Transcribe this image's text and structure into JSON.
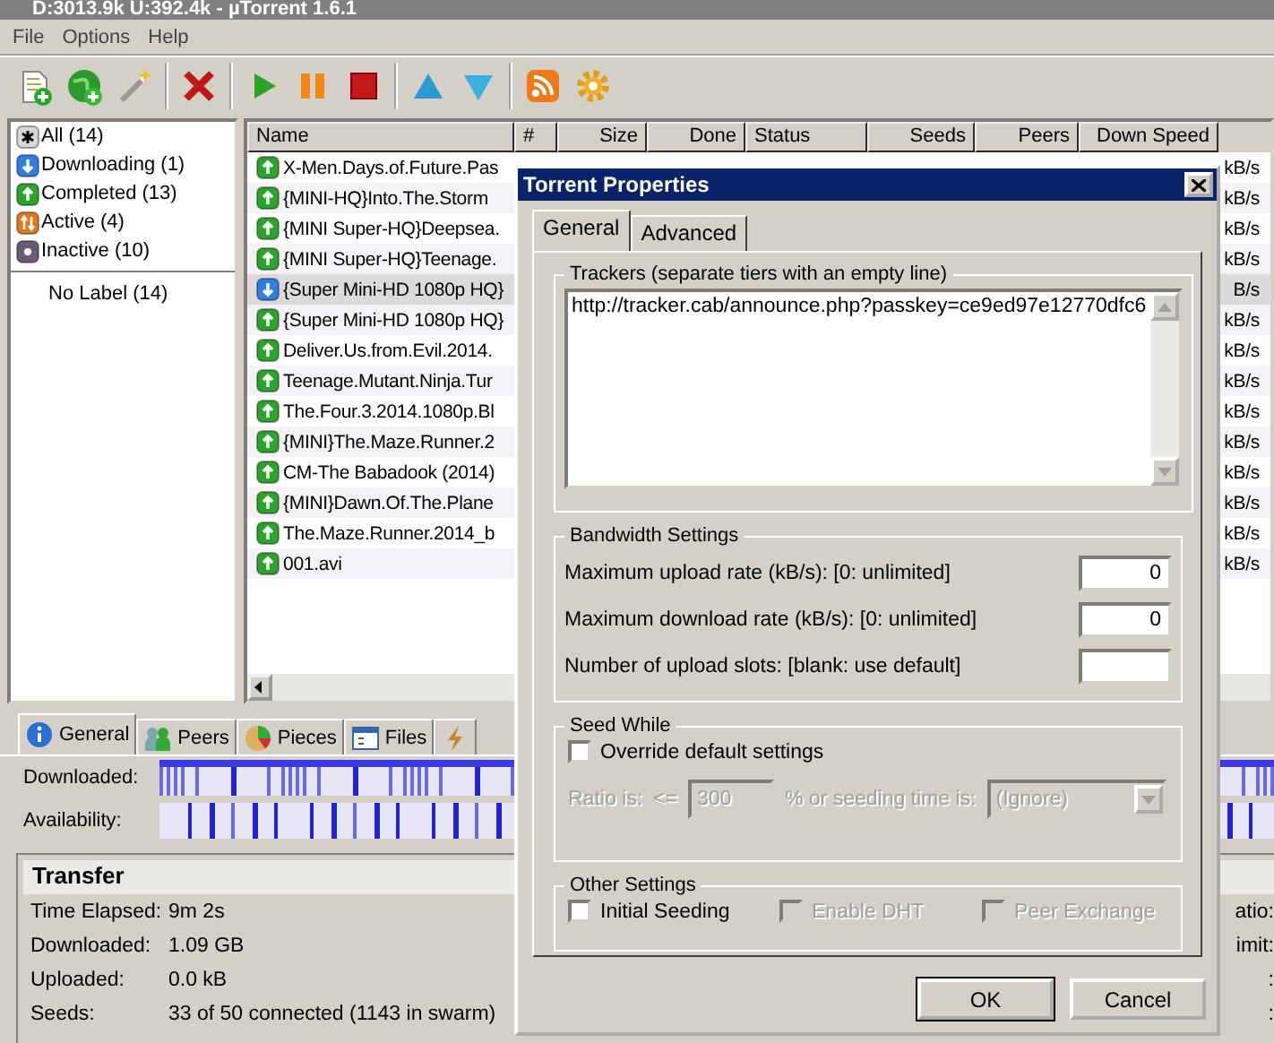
{
  "window": {
    "title": "D:3013.9k U:392.4k - µTorrent 1.6.1"
  },
  "menu": [
    "File",
    "Options",
    "Help"
  ],
  "sidebar": {
    "items": [
      {
        "label": "All (14)",
        "kind": "all",
        "selected": false
      },
      {
        "label": "Downloading (1)",
        "kind": "downloading",
        "selected": false
      },
      {
        "label": "Completed (13)",
        "kind": "completed",
        "selected": false
      },
      {
        "label": "Active (4)",
        "kind": "active",
        "selected": false
      },
      {
        "label": "Inactive (10)",
        "kind": "inactive",
        "selected": false
      }
    ],
    "labels": [
      {
        "label": "No Label (14)",
        "selected": false
      }
    ]
  },
  "torrents": {
    "columns": [
      "Name",
      "#",
      "Size",
      "Done",
      "Status",
      "Seeds",
      "Peers",
      "Down Speed"
    ],
    "rows": [
      {
        "name": "X-Men.Days.of.Future.Pas",
        "kind": "seeding",
        "down_speed": "kB/s",
        "selected": false
      },
      {
        "name": "{MINI-HQ}Into.The.Storm",
        "kind": "seeding",
        "down_speed": "kB/s",
        "selected": false
      },
      {
        "name": "{MINI Super-HQ}Deepsea.",
        "kind": "seeding",
        "down_speed": "kB/s",
        "selected": false
      },
      {
        "name": "{MINI Super-HQ}Teenage.",
        "kind": "seeding",
        "down_speed": "kB/s",
        "selected": false
      },
      {
        "name": "{Super Mini-HD 1080p HQ}",
        "kind": "downloading",
        "down_speed": "B/s",
        "selected": true
      },
      {
        "name": "{Super Mini-HD 1080p HQ}",
        "kind": "seeding",
        "down_speed": "kB/s",
        "selected": false
      },
      {
        "name": "Deliver.Us.from.Evil.2014.",
        "kind": "seeding",
        "down_speed": "kB/s",
        "selected": false
      },
      {
        "name": "Teenage.Mutant.Ninja.Tur",
        "kind": "seeding",
        "down_speed": "kB/s",
        "selected": false
      },
      {
        "name": "The.Four.3.2014.1080p.Bl",
        "kind": "seeding",
        "down_speed": "kB/s",
        "selected": false
      },
      {
        "name": "{MINI}The.Maze.Runner.2",
        "kind": "seeding",
        "down_speed": "kB/s",
        "selected": false
      },
      {
        "name": "CM-The Babadook (2014)",
        "kind": "seeding",
        "down_speed": "kB/s",
        "selected": false
      },
      {
        "name": "{MINI}Dawn.Of.The.Plane",
        "kind": "seeding",
        "down_speed": "kB/s",
        "selected": false
      },
      {
        "name": "The.Maze.Runner.2014_b",
        "kind": "seeding",
        "down_speed": "kB/s",
        "selected": false
      },
      {
        "name": "001.avi",
        "kind": "seeding",
        "down_speed": "kB/s",
        "selected": false
      }
    ]
  },
  "details": {
    "tabs": [
      {
        "label": "General",
        "kind": "info",
        "selected": true
      },
      {
        "label": "Peers",
        "kind": "peers",
        "selected": false
      },
      {
        "label": "Pieces",
        "kind": "pieces",
        "selected": false
      },
      {
        "label": "Files",
        "kind": "files",
        "selected": false
      },
      {
        "kind": "speed",
        "selected": false
      }
    ],
    "bars": [
      {
        "label": "Downloaded:",
        "kind": "downloaded"
      },
      {
        "label": "Availability:",
        "kind": "availability"
      }
    ],
    "transfer": {
      "title": "Transfer",
      "fields": [
        {
          "label": "Time Elapsed:",
          "value": "9m 2s",
          "column_2": "atio:"
        },
        {
          "label": "Downloaded:",
          "value": "1.09 GB",
          "column_2": "imit:"
        },
        {
          "label": "Uploaded:",
          "value": "0.0 kB",
          "column_2": ":"
        },
        {
          "label": "Seeds:",
          "value": "33 of 50 connected (1143 in swarm)",
          "column_2": ":"
        }
      ]
    }
  },
  "dialog": {
    "title": "Torrent Properties",
    "tabs": [
      {
        "label": "General",
        "selected": true
      },
      {
        "label": "Advanced",
        "selected": false
      }
    ],
    "trackers": {
      "legend": "Trackers (separate tiers with an empty line)",
      "value": "http://tracker.cab/announce.php?passkey=ce9ed97e12770dfc6"
    },
    "bandwidth": {
      "legend": "Bandwidth Settings",
      "fields": [
        {
          "label": "Maximum upload rate (kB/s): [0: unlimited]",
          "value": "0"
        },
        {
          "label": "Maximum download rate (kB/s): [0: unlimited]",
          "value": "0"
        },
        {
          "label": "Number of upload slots: [blank: use default]"
        }
      ]
    },
    "seed_while": {
      "legend": "Seed While",
      "override": {
        "label": "Override default settings",
        "checked": false
      },
      "disabled": true,
      "ratio_label": "Ratio is:",
      "ratio_op": "<=",
      "ratio_value": "300",
      "time_label": "%  or seeding time is:",
      "time_value": "(Ignore)"
    },
    "other": {
      "legend": "Other Settings",
      "options": [
        {
          "label": "Initial Seeding",
          "checked": false,
          "disabled": false
        },
        {
          "label": "Enable DHT",
          "checked": false,
          "disabled": true
        },
        {
          "label": "Peer Exchange",
          "checked": false,
          "disabled": true
        }
      ]
    },
    "buttons": [
      {
        "label": "OK",
        "default": true
      },
      {
        "label": "Cancel",
        "default": false
      }
    ]
  }
}
